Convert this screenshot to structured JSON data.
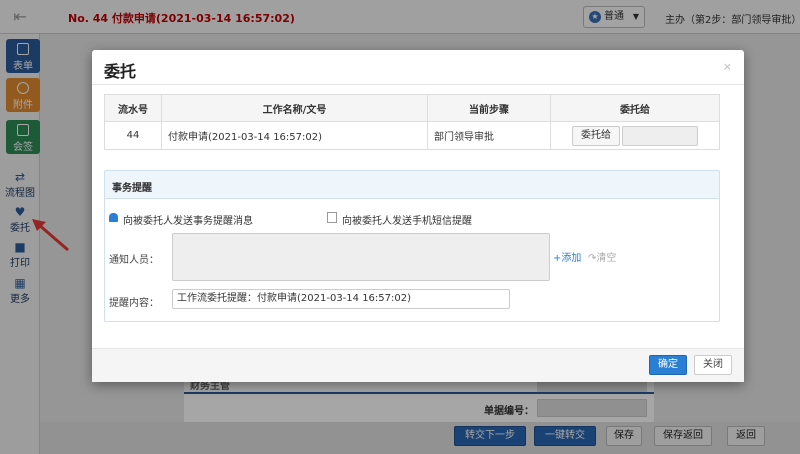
{
  "topbar": {
    "doc_title": "No. 44 付款申请(2021-03-14 16:57:02)",
    "priority": "普通",
    "step_info": "主办（第2步：部门领导审批）"
  },
  "sidebar": {
    "items": [
      {
        "label": "表单",
        "icon": "form-icon",
        "color": "#2b5b9a"
      },
      {
        "label": "附件",
        "icon": "paperclip-icon",
        "color": "#e08a2e"
      },
      {
        "label": "会签",
        "icon": "checkbox-icon",
        "color": "#2d8b57"
      },
      {
        "label": "流程图",
        "icon": "flow-icon"
      },
      {
        "label": "委托",
        "icon": "handshake-icon"
      },
      {
        "label": "打印",
        "icon": "printer-icon"
      },
      {
        "label": "更多",
        "icon": "grid-icon"
      }
    ]
  },
  "background": {
    "field1_label": "财务主管",
    "field2_label": "单据编号："
  },
  "bottombar": {
    "buttons": [
      "转交下一步",
      "一键转交",
      "保存",
      "保存返回",
      "返回"
    ]
  },
  "modal": {
    "title": "委托",
    "close": "×",
    "table": {
      "headers": [
        "流水号",
        "工作名称/文号",
        "当前步骤",
        "委托给"
      ],
      "row": {
        "id": "44",
        "name": "付款申请(2021-03-14 16:57:02)",
        "step": "部门领导审批"
      },
      "delegate_button": "委托给"
    },
    "reminder": {
      "title": "事务提醒",
      "option1": "向被委托人发送事务提醒消息",
      "option2": "向被委托人发送手机短信提醒",
      "notify_label": "通知人员：",
      "add": "添加",
      "clear": "清空",
      "content_label": "提醒内容：",
      "content_value": "工作流委托提醒：付款申请(2021-03-14 16:57:02)"
    },
    "ok": "确定",
    "close_btn": "关闭"
  },
  "colors": {
    "accent": "#2a7fd4",
    "title_red": "#c00000"
  }
}
